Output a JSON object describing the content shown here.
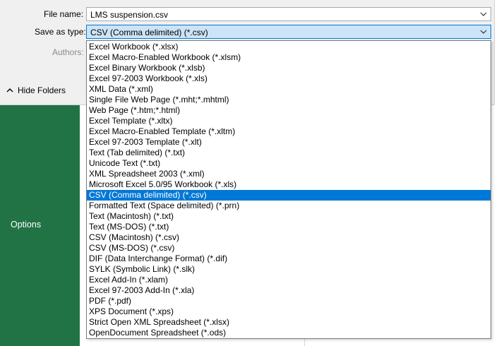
{
  "dialog": {
    "file_name_label": "File name:",
    "file_name_value": "LMS suspension.csv",
    "save_as_type_label": "Save as type:",
    "save_as_type_value": "CSV (Comma delimited) (*.csv)",
    "authors_label": "Authors:",
    "hide_folders_label": "Hide Folders"
  },
  "backstage": {
    "options_label": "Options",
    "accent_color": "#217346"
  },
  "file_types": [
    "Excel Workbook (*.xlsx)",
    "Excel Macro-Enabled Workbook (*.xlsm)",
    "Excel Binary Workbook (*.xlsb)",
    "Excel 97-2003 Workbook (*.xls)",
    "XML Data (*.xml)",
    "Single File Web Page (*.mht;*.mhtml)",
    "Web Page (*.htm;*.html)",
    "Excel Template (*.xltx)",
    "Excel Macro-Enabled Template (*.xltm)",
    "Excel 97-2003 Template (*.xlt)",
    "Text (Tab delimited) (*.txt)",
    "Unicode Text (*.txt)",
    "XML Spreadsheet 2003 (*.xml)",
    "Microsoft Excel 5.0/95 Workbook (*.xls)",
    "CSV (Comma delimited) (*.csv)",
    "Formatted Text (Space delimited) (*.prn)",
    "Text (Macintosh) (*.txt)",
    "Text (MS-DOS) (*.txt)",
    "CSV (Macintosh) (*.csv)",
    "CSV (MS-DOS) (*.csv)",
    "DIF (Data Interchange Format) (*.dif)",
    "SYLK (Symbolic Link) (*.slk)",
    "Excel Add-In (*.xlam)",
    "Excel 97-2003 Add-In (*.xla)",
    "PDF (*.pdf)",
    "XPS Document (*.xps)",
    "Strict Open XML Spreadsheet (*.xlsx)",
    "OpenDocument Spreadsheet (*.ods)"
  ],
  "selected_file_type": "CSV (Comma delimited) (*.csv)",
  "colors": {
    "selection": "#0078d7",
    "dialog_bg": "#f0f0f0"
  }
}
